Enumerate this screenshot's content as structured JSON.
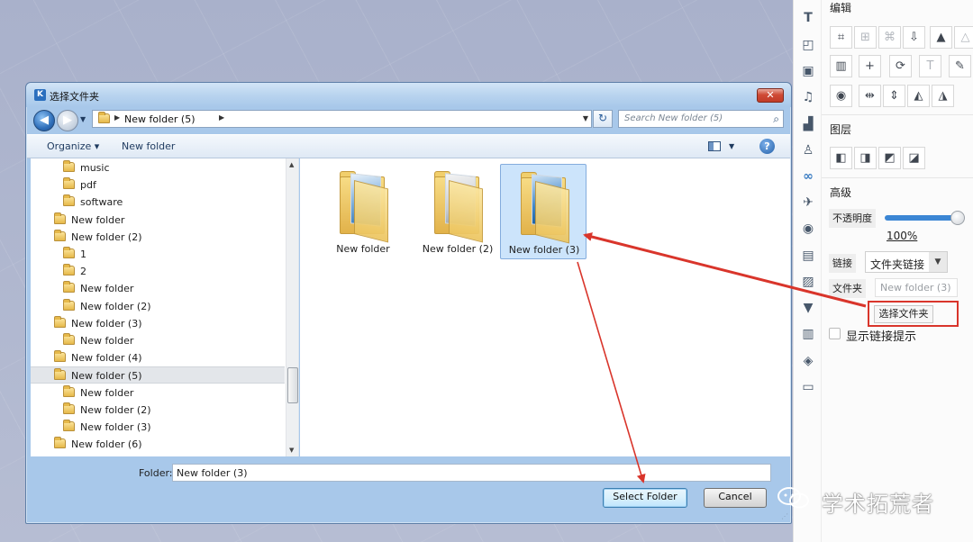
{
  "dialog": {
    "title": "选择文件夹",
    "close_glyph": "✕",
    "address": {
      "crumb": "New folder (5)"
    },
    "search_placeholder": "Search New folder (5)",
    "toolbar": {
      "organize": "Organize ▾",
      "new_folder": "New folder",
      "help": "?"
    },
    "tree": [
      {
        "label": "music",
        "level": 1,
        "selected": false
      },
      {
        "label": "pdf",
        "level": 1,
        "selected": false
      },
      {
        "label": "software",
        "level": 1,
        "selected": false
      },
      {
        "label": "New folder",
        "level": 0,
        "selected": false
      },
      {
        "label": "New folder (2)",
        "level": 0,
        "selected": false
      },
      {
        "label": "1",
        "level": 1,
        "selected": false
      },
      {
        "label": "2",
        "level": 1,
        "selected": false
      },
      {
        "label": "New folder",
        "level": 1,
        "selected": false
      },
      {
        "label": "New folder (2)",
        "level": 1,
        "selected": false
      },
      {
        "label": "New folder (3)",
        "level": 0,
        "selected": false
      },
      {
        "label": "New folder",
        "level": 1,
        "selected": false
      },
      {
        "label": "New folder (4)",
        "level": 0,
        "selected": false
      },
      {
        "label": "New folder (5)",
        "level": 0,
        "selected": true
      },
      {
        "label": "New folder",
        "level": 1,
        "selected": false
      },
      {
        "label": "New folder (2)",
        "level": 1,
        "selected": false
      },
      {
        "label": "New folder (3)",
        "level": 1,
        "selected": false
      },
      {
        "label": "New folder (6)",
        "level": 0,
        "selected": false
      }
    ],
    "files": [
      {
        "label": "New folder",
        "selected": false
      },
      {
        "label": "New folder (2)",
        "selected": false
      },
      {
        "label": "New folder (3)",
        "selected": true
      }
    ],
    "folder_label": "Folder:",
    "folder_value": "New folder (3)",
    "select_button": "Select Folder",
    "cancel_button": "Cancel"
  },
  "panel": {
    "edit_title": "编辑",
    "layer_title": "图层",
    "advanced_title": "高级",
    "opacity_label": "不透明度",
    "opacity_value": "100%",
    "opacity_fraction": 1.0,
    "link_label": "链接",
    "link_type": "文件夹链接",
    "folder_label": "文件夹",
    "folder_value": "New folder (3)",
    "choose_folder_button": "选择文件夹",
    "show_link_hint": "显示链接提示"
  },
  "watermark": "学术拓荒者",
  "colors": {
    "annotation_red": "#d9352b",
    "accent_blue": "#3b86d4"
  }
}
